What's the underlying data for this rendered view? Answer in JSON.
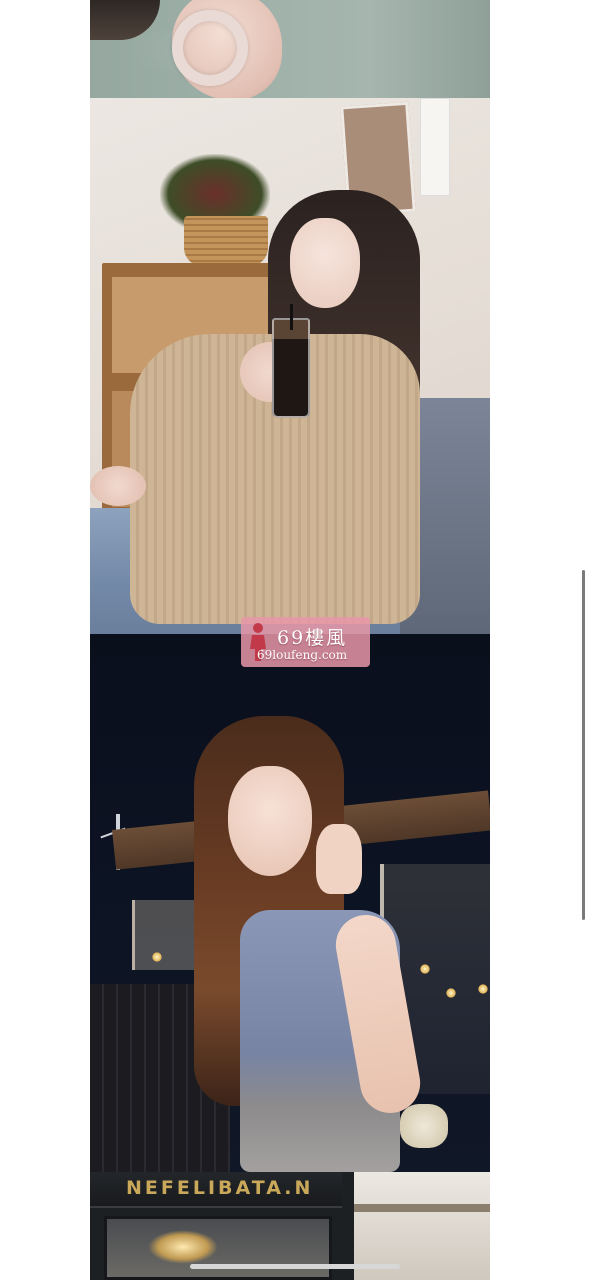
{
  "feed": {
    "photos": [
      {
        "subject": "knit sweater with jade bangle"
      },
      {
        "subject": "woman drinking iced coffee in cafe"
      },
      {
        "subject": "woman making peace sign on night rooftop"
      },
      {
        "subject": "storefront"
      }
    ],
    "storefront_sign": "NEFELIBATA.N"
  },
  "watermark": {
    "title": "69樓風",
    "url": "69loufeng.com",
    "color": "#e896a8"
  },
  "icons": [
    "watermark-figure-icon"
  ],
  "scroll": {
    "position_fraction": 0.45
  }
}
